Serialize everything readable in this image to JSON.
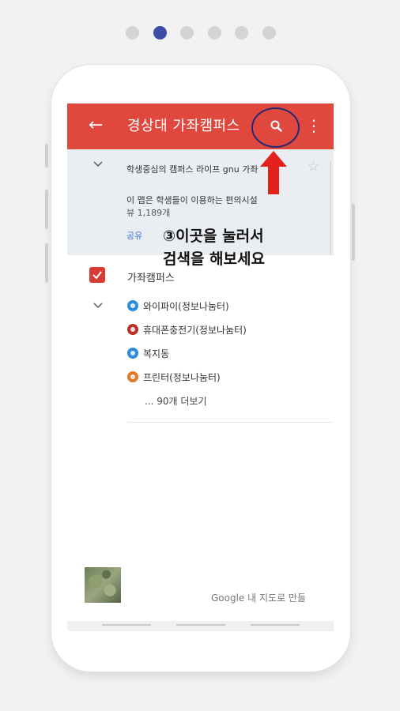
{
  "carousel": {
    "total": 6,
    "active_index": 1,
    "active_color": "#3b4ba7",
    "inactive_color": "#d4d4d4"
  },
  "appbar": {
    "back_icon": "arrow-left-icon",
    "title": "경상대 가좌캠퍼스",
    "search_icon": "search-icon",
    "more_icon": "more-vert-icon",
    "color": "#e0473d"
  },
  "map_info": {
    "description_line1": "학생중심의 캠퍼스 라이프 gnu 가좌",
    "description_line2": "이 맵은 학생들이 이용하는 편의시설",
    "views": "뷰 1,189개",
    "share_label": "공유"
  },
  "layer": {
    "name": "가좌캠퍼스",
    "checked": true,
    "items": [
      {
        "label": "와이파이(정보나눔터)",
        "icon": "wifi-icon",
        "color": "#2f8bd8"
      },
      {
        "label": "휴대폰충전기(정보나눔터)",
        "icon": "charger-icon",
        "color": "#b8322a"
      },
      {
        "label": "복지동",
        "icon": "building-icon",
        "color": "#2f8bd8"
      },
      {
        "label": "프린터(정보나눔터)",
        "icon": "printer-icon",
        "color": "#e07a2a"
      }
    ],
    "more_label": "... 90개 더보기"
  },
  "footer": {
    "google_text": "Google 내 지도로 만들"
  },
  "annotation": {
    "text": "③이곳을 눌러서\n검색을 해보세요",
    "arrow_color": "#e4211c",
    "circle_color": "#1e2a78"
  }
}
